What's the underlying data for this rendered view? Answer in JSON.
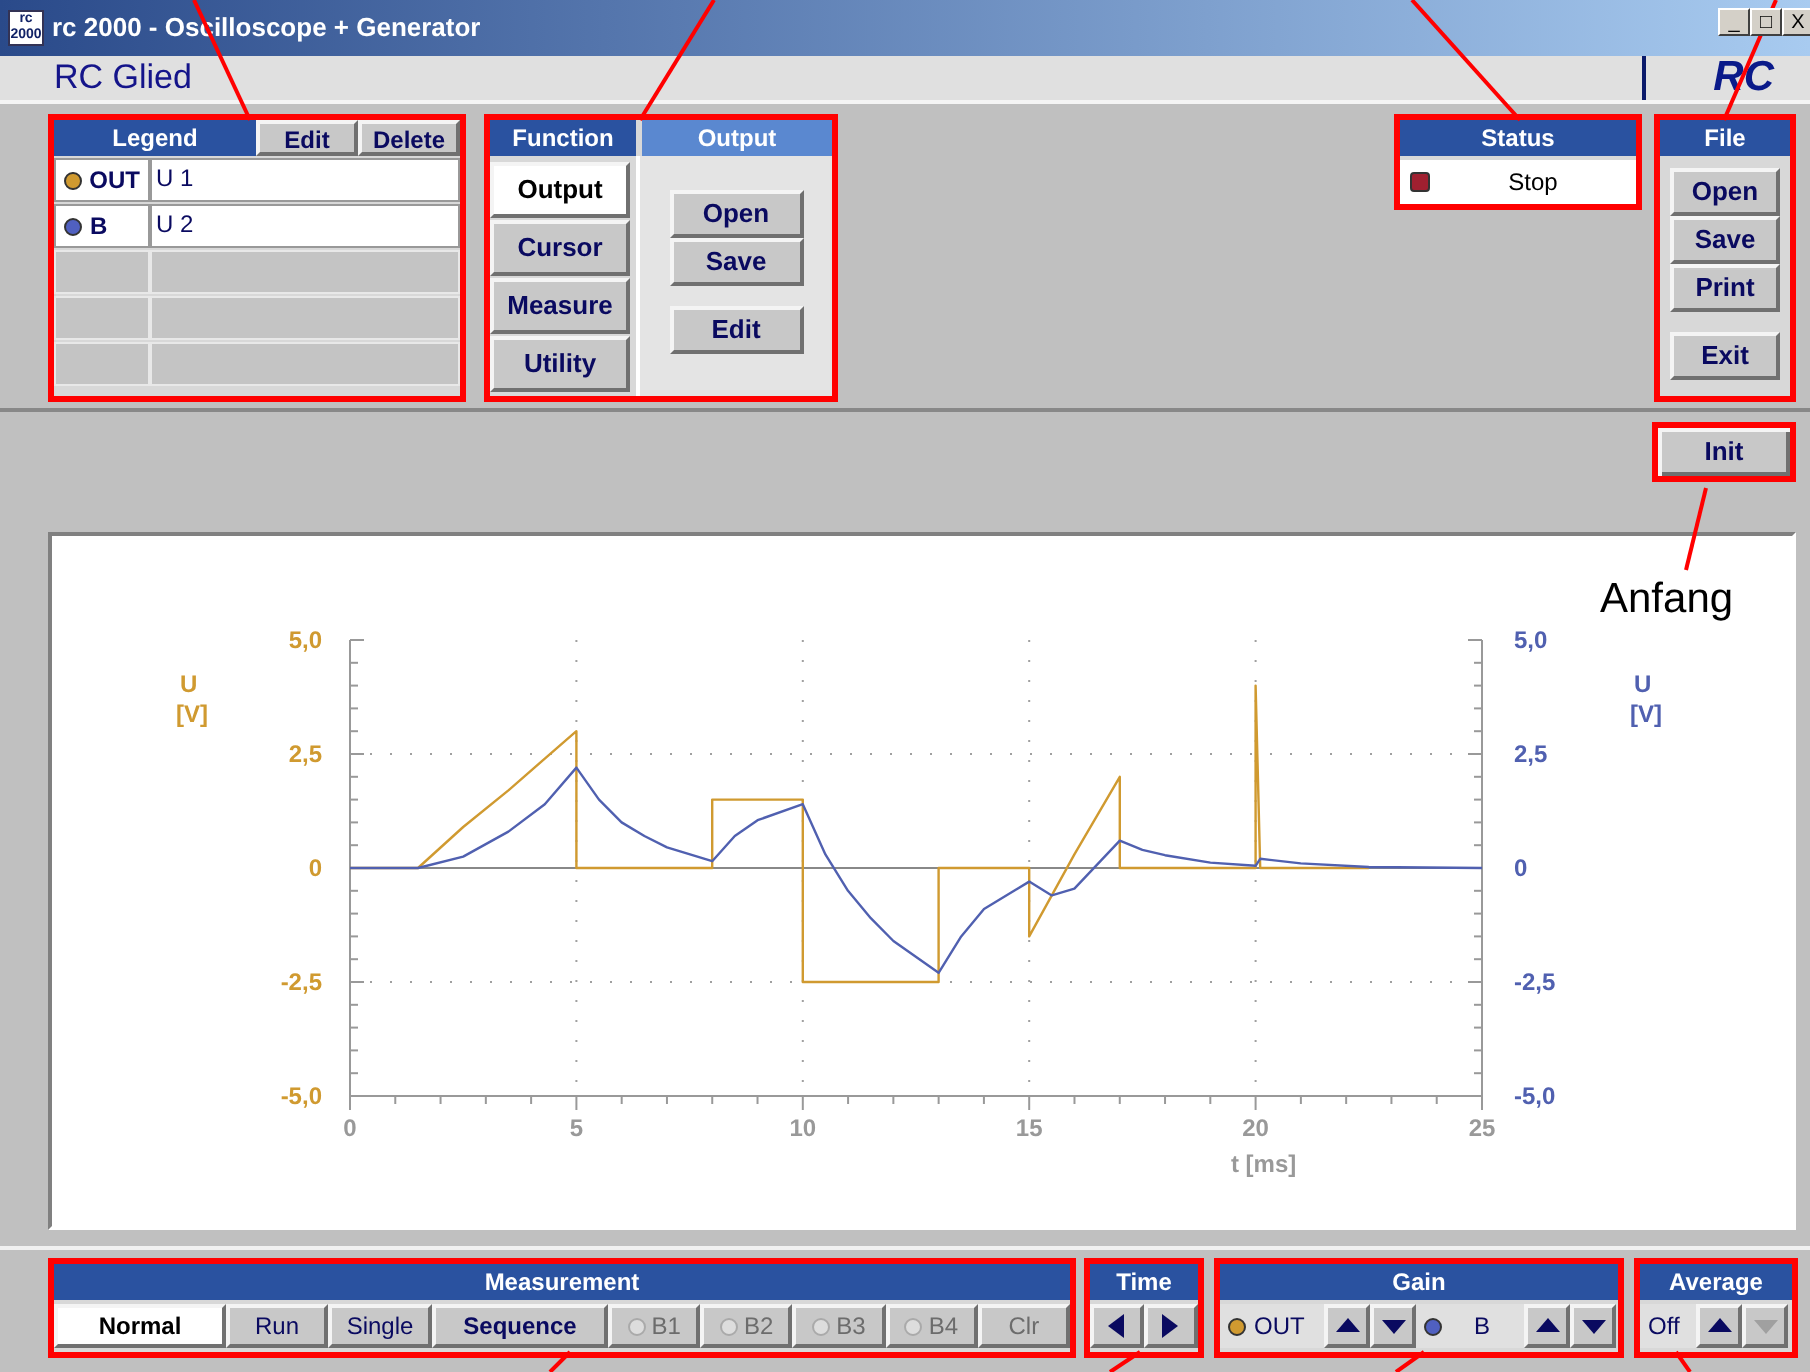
{
  "window": {
    "title": "rc 2000 - Oscilloscope + Generator",
    "icon_text": [
      "rc",
      "2000"
    ],
    "controls": [
      "_",
      "□",
      "X"
    ]
  },
  "header": {
    "title": "RC Glied",
    "logo": "RC"
  },
  "legend": {
    "title": "Legend",
    "buttons": [
      "Edit",
      "Delete"
    ],
    "rows": [
      {
        "kind": "channel",
        "symbol": "OUT",
        "name": "U 1",
        "color": "#d09a30"
      },
      {
        "kind": "channel",
        "symbol": "B",
        "name": "U 2",
        "color": "#5060c0"
      },
      {
        "kind": "empty"
      },
      {
        "kind": "empty"
      },
      {
        "kind": "empty"
      }
    ]
  },
  "function": {
    "title": "Function",
    "tabs": [
      {
        "label": "Output",
        "selected": true
      },
      {
        "label": "Cursor",
        "selected": false
      },
      {
        "label": "Measure",
        "selected": false
      },
      {
        "label": "Utility",
        "selected": false
      }
    ],
    "panel_title": "Output",
    "buttons": [
      "Open",
      "Save",
      "Edit"
    ]
  },
  "status": {
    "title": "Status",
    "text": "Stop",
    "color": "#a02030"
  },
  "file": {
    "title": "File",
    "buttons": [
      "Open",
      "Save",
      "Print",
      "Exit"
    ]
  },
  "init_button": "Init",
  "annotation": "Anfang",
  "chart": {
    "chart_data": {
      "type": "line",
      "xlabel": "t [ms]",
      "ylabel": "U [V]",
      "annotations": [
        {
          "text": "U [V]"
        }
      ],
      "grid": true,
      "x": [
        0,
        1.5,
        2.5,
        3.5,
        4.3,
        5,
        5,
        5.5,
        6,
        6.5,
        7,
        8,
        8,
        8.5,
        9,
        10,
        10,
        10.5,
        11,
        11.5,
        12,
        13,
        13,
        13.5,
        14,
        15,
        15,
        15.5,
        16,
        17,
        17,
        17.5,
        18,
        19,
        20,
        20,
        20.1,
        21,
        22.5,
        25
      ],
      "series": [
        {
          "color": "#d09a30",
          "values": [
            0,
            0,
            0.9,
            1.7,
            2.4,
            3,
            0,
            0,
            0,
            0,
            0,
            0,
            1.5,
            1.5,
            1.5,
            1.5,
            -2.5,
            -2.5,
            -2.5,
            -2.5,
            -2.5,
            -2.5,
            0,
            0,
            0,
            0,
            -1.5,
            -0.6,
            0.3,
            2,
            0,
            0,
            0,
            0,
            0,
            4,
            0,
            0,
            0,
            null
          ]
        },
        {
          "color": "#5060b0",
          "values": [
            0,
            0,
            0.25,
            0.8,
            1.4,
            2.2,
            2.2,
            1.5,
            1.0,
            0.7,
            0.45,
            0.15,
            0.15,
            0.7,
            1.05,
            1.4,
            1.4,
            0.3,
            -0.5,
            -1.1,
            -1.6,
            -2.3,
            -2.3,
            -1.5,
            -0.9,
            -0.3,
            -0.3,
            -0.6,
            -0.45,
            0.6,
            0.6,
            0.4,
            0.28,
            0.12,
            0.05,
            0.05,
            0.2,
            0.1,
            0.02,
            0
          ]
        }
      ],
      "xlim": [
        0,
        25
      ],
      "ylim": [
        -5,
        5
      ],
      "xticks": [
        0,
        5,
        10,
        15,
        20,
        25
      ],
      "yticks": [
        {
          "value": -5,
          "label": "-5,0"
        },
        {
          "value": -2.5,
          "label": "-2,5"
        },
        {
          "value": 0,
          "label": "0"
        },
        {
          "value": 2.5,
          "label": "2,5"
        },
        {
          "value": 5,
          "label": "5,0"
        }
      ]
    }
  },
  "measurement": {
    "title": "Measurement",
    "modes": [
      {
        "label": "Normal",
        "selected": true,
        "bold": true
      },
      {
        "label": "Run",
        "selected": false,
        "bold": false
      },
      {
        "label": "Single",
        "selected": false,
        "bold": false
      },
      {
        "label": "Sequence",
        "selected": false,
        "bold": true
      }
    ],
    "options": [
      {
        "kind": "radio",
        "label": "B1",
        "disabled": true
      },
      {
        "kind": "radio",
        "label": "B2",
        "disabled": true
      },
      {
        "kind": "radio",
        "label": "B3",
        "disabled": true
      },
      {
        "kind": "radio",
        "label": "B4",
        "disabled": true
      },
      {
        "kind": "button",
        "label": "Clr",
        "disabled": true
      }
    ]
  },
  "time": {
    "title": "Time"
  },
  "gain": {
    "title": "Gain",
    "channels": [
      {
        "symbol": "OUT",
        "color": "#d09a30"
      },
      {
        "symbol": "B",
        "color": "#5060c0"
      }
    ]
  },
  "average": {
    "title": "Average",
    "value": "Off",
    "buttons": [
      {
        "kind": "up",
        "disabled": false
      },
      {
        "kind": "down",
        "disabled": true
      }
    ]
  }
}
